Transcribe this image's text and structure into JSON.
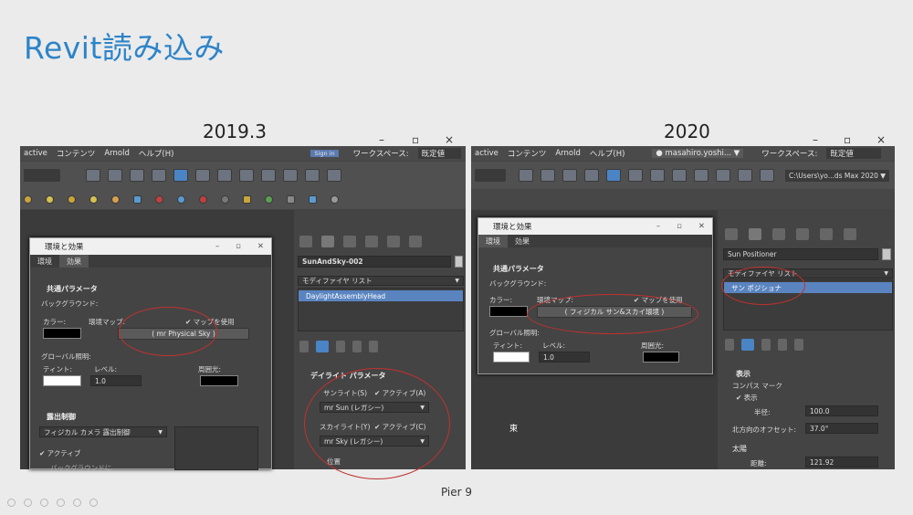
{
  "slide": {
    "title": "Revit読み込み",
    "footer": "Pier 9"
  },
  "left": {
    "version": "2019.3",
    "window_controls": [
      "–",
      "▫",
      "×"
    ],
    "menu": [
      "active",
      "コンテンツ",
      "Arnold",
      "ヘルプ(H)"
    ],
    "user_badge": "Sign in",
    "workspace_label": "ワークスペース:",
    "workspace_value": "既定値",
    "dialog": {
      "title": "環境と効果",
      "tabs": [
        "環境",
        "効果"
      ],
      "section_common": "共通パラメータ",
      "bg_label": "バックグラウンド:",
      "color_label": "カラー:",
      "envmap_label": "環境マップ:",
      "use_map": "マップを使用",
      "map_button": "( mr Physical Sky )",
      "global_lighting": "グローバル照明:",
      "tint_label": "ティント:",
      "level_label": "レベル:",
      "level_value": "1.0",
      "ambient_label": "周囲光:",
      "exposure_section": "露出制御",
      "exposure_value": "フィジカル カメラ 露出制御",
      "active_label": "アクティブ",
      "extra_label": "バックグラウンドに"
    },
    "panel": {
      "object_name": "SunAndSky-002",
      "modifier_list": "モディファイヤ リスト",
      "selected_modifier": "DaylightAssemblyHead",
      "daylight_params": "デイライト パラメータ",
      "sunlight_label": "サンライト(S)",
      "active_a": "アクティブ(A)",
      "sun_dropdown": "mr Sun (レガシー)",
      "skylight_label": "スカイライト(Y)",
      "active_c": "アクティブ(C)",
      "sky_dropdown": "mr Sky (レガシー)",
      "position_label": "位置"
    }
  },
  "right": {
    "version": "2020",
    "window_controls": [
      "–",
      "▫",
      "×"
    ],
    "menu": [
      "active",
      "コンテンツ",
      "Arnold",
      "ヘルプ(H)"
    ],
    "user_name": "masahiro.yoshi...",
    "workspace_label": "ワークスペース:",
    "workspace_value": "既定値",
    "path_value": "C:\\Users\\yo...ds Max 2020",
    "dialog": {
      "title": "環境と効果",
      "tabs": [
        "環境",
        "効果"
      ],
      "section_common": "共通パラメータ",
      "bg_label": "バックグラウンド:",
      "color_label": "カラー:",
      "envmap_label": "環境マップ:",
      "use_map": "マップを使用",
      "map_button": "( フィジカル サン&スカイ環境 )",
      "global_lighting": "グローバル照明:",
      "tint_label": "ティント:",
      "level_label": "レベル:",
      "level_value": "1.0",
      "ambient_label": "周囲光:"
    },
    "panel": {
      "object_name": "Sun Positioner",
      "modifier_list": "モディファイヤ リスト",
      "selected_modifier": "サン ポジショナ",
      "display_section": "表示",
      "compass_label": "コンパス マーク",
      "show_label": "表示",
      "radius_label": "半径:",
      "radius_value": "100.0",
      "north_offset_label": "北方向のオフセット:",
      "north_offset_value": "37.0°",
      "sun_label": "太陽",
      "distance_label": "距離:",
      "distance_value": "121.92"
    },
    "viewport_label": "東"
  }
}
